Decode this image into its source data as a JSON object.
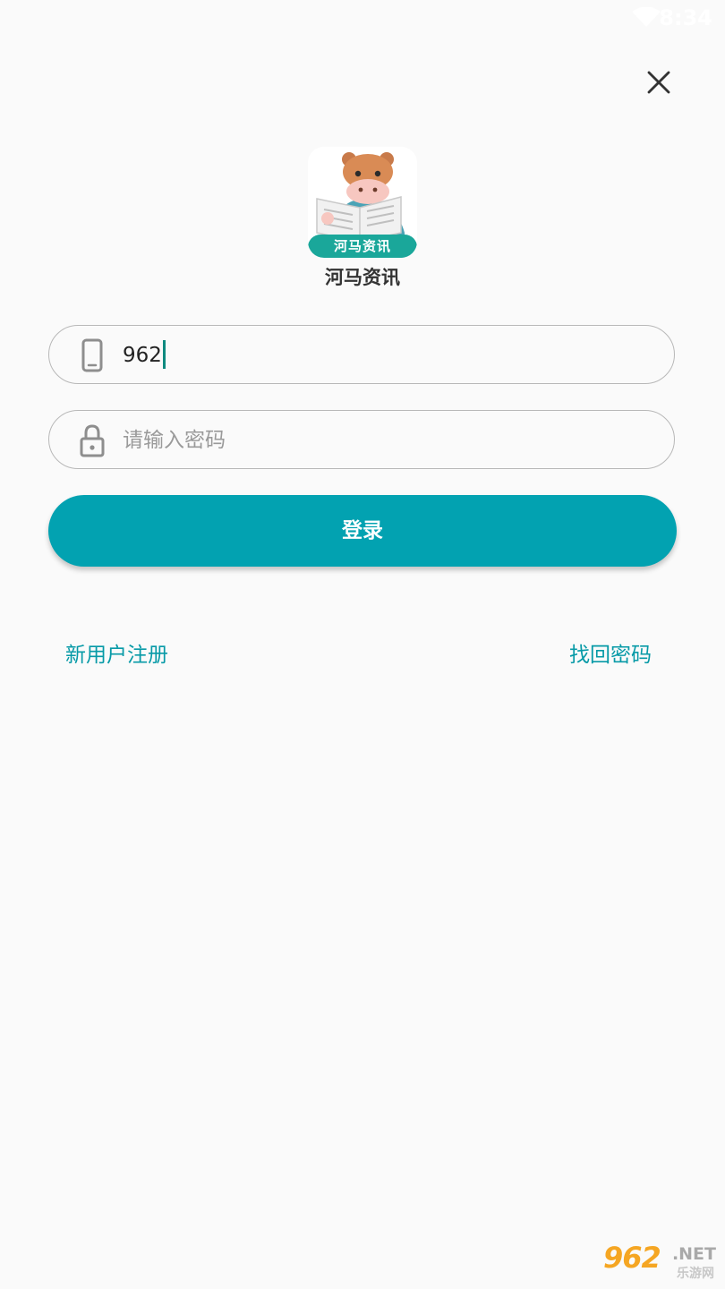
{
  "status_bar": {
    "time": "8:34",
    "wifi_icon": "wifi-icon"
  },
  "close_icon": "close-icon",
  "app": {
    "logo_icon": "hippo-newspaper-logo",
    "logo_banner_text": "河马资讯",
    "name": "河马资讯"
  },
  "form": {
    "phone": {
      "icon": "phone-icon",
      "value": "962"
    },
    "password": {
      "icon": "lock-icon",
      "placeholder": "请输入密码"
    },
    "login_label": "登录"
  },
  "links": {
    "register": "新用户注册",
    "forgot_password": "找回密码"
  },
  "watermark": {
    "number": "962",
    "suffix": ".NET",
    "subtitle": "乐游网"
  },
  "colors": {
    "accent": "#02a2b1",
    "link": "#079aa7",
    "background": "#fafafa",
    "field_border": "#b8b8b8"
  }
}
